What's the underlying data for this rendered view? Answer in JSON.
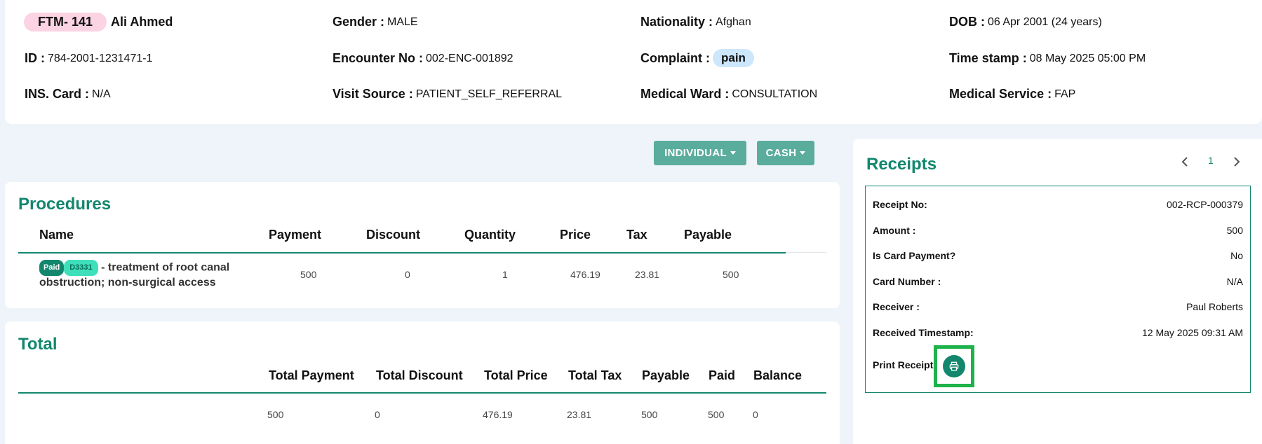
{
  "patient": {
    "ftm_id": "FTM- 141",
    "name": "Ali Ahmed",
    "gender_label": "Gender :",
    "gender": "MALE",
    "nationality_label": "Nationality :",
    "nationality": "Afghan",
    "dob_label": "DOB :",
    "dob": "06 Apr 2001 (24 years)",
    "id_label": "ID :",
    "id": "784-2001-1231471-1",
    "encounter_label": "Encounter No :",
    "encounter": "002-ENC-001892",
    "complaint_label": "Complaint :",
    "complaint": "pain",
    "timestamp_label": "Time stamp :",
    "timestamp": "08 May 2025 05:00 PM",
    "ins_label": "INS. Card :",
    "ins": "N/A",
    "visit_source_label": "Visit Source :",
    "visit_source": "PATIENT_SELF_REFERRAL",
    "ward_label": "Medical Ward :",
    "ward": "CONSULTATION",
    "service_label": "Medical Service :",
    "service": "FAP"
  },
  "toolbar": {
    "individual_label": "INDIVIDUAL",
    "cash_label": "CASH"
  },
  "procedures": {
    "title": "Procedures",
    "headers": {
      "name": "Name",
      "payment": "Payment",
      "discount": "Discount",
      "quantity": "Quantity",
      "price": "Price",
      "tax": "Tax",
      "payable": "Payable"
    },
    "rows": [
      {
        "status": "Paid",
        "code": "D3331",
        "separator": "-",
        "name": "treatment of root canal obstruction; non-surgical access",
        "payment": "500",
        "discount": "0",
        "quantity": "1",
        "price": "476.19",
        "tax": "23.81",
        "payable": "500"
      }
    ]
  },
  "total": {
    "title": "Total",
    "headers": {
      "payment": "Total Payment",
      "discount": "Total Discount",
      "price": "Total Price",
      "tax": "Total Tax",
      "payable": "Payable",
      "paid": "Paid",
      "balance": "Balance"
    },
    "values": {
      "payment": "500",
      "discount": "0",
      "price": "476.19",
      "tax": "23.81",
      "payable": "500",
      "paid": "500",
      "balance": "0"
    }
  },
  "receipts": {
    "title": "Receipts",
    "page": "1",
    "fields": [
      {
        "label": "Receipt No:",
        "value": "002-RCP-000379"
      },
      {
        "label": "Amount :",
        "value": "500"
      },
      {
        "label": "Is Card Payment?",
        "value": "No"
      },
      {
        "label": "Card Number :",
        "value": "N/A"
      },
      {
        "label": "Receiver :",
        "value": "Paul Roberts"
      },
      {
        "label": "Received Timestamp:",
        "value": "12 May 2025 09:31 AM"
      }
    ],
    "print_label": "Print Receipt"
  },
  "colors": {
    "accent": "#13876e",
    "button": "#5aac9c",
    "ftm_badge": "#fbd3e3",
    "complaint_pill": "#cce6fb",
    "highlight": "#1db34a"
  },
  "icons": {
    "prev": "chevron-left-icon",
    "next": "chevron-right-icon",
    "print": "printer-icon",
    "dropdown": "caret-down-icon"
  }
}
